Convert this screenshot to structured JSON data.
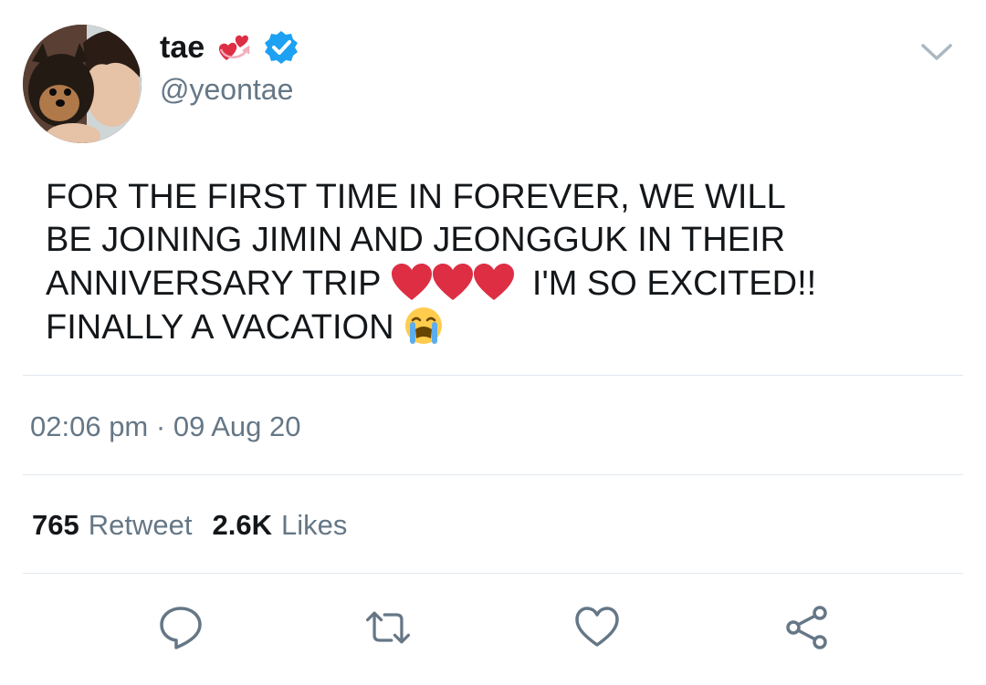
{
  "tweet": {
    "display_name": "tae",
    "name_emoji": "revolving-hearts-emoji",
    "verified_badge": "verified-icon",
    "handle": "@yeontae",
    "text_lines": [
      "FOR THE FIRST TIME IN FOREVER, WE WILL",
      "BE JOINING JIMIN AND JEONGGUK IN THEIR",
      "ANNIVERSARY TRIP",
      "I'M SO EXCITED!!",
      "FINALLY A VACATION"
    ],
    "timestamp_time": "02:06 pm",
    "timestamp_sep": " · ",
    "timestamp_date": "09 Aug 20",
    "retweet_count": "765",
    "retweet_label": "Retweet",
    "like_count": "2.6K",
    "like_label": "Likes"
  },
  "icons": {
    "menu": "chevron-down-icon",
    "reply": "reply-icon",
    "retweet": "retweet-icon",
    "like": "heart-icon",
    "share": "share-icon"
  },
  "colors": {
    "text": "#14171a",
    "secondary": "#657786",
    "divider": "#e1e8ed",
    "verified": "#1da1f2",
    "heart_red": "#dd2e44"
  }
}
